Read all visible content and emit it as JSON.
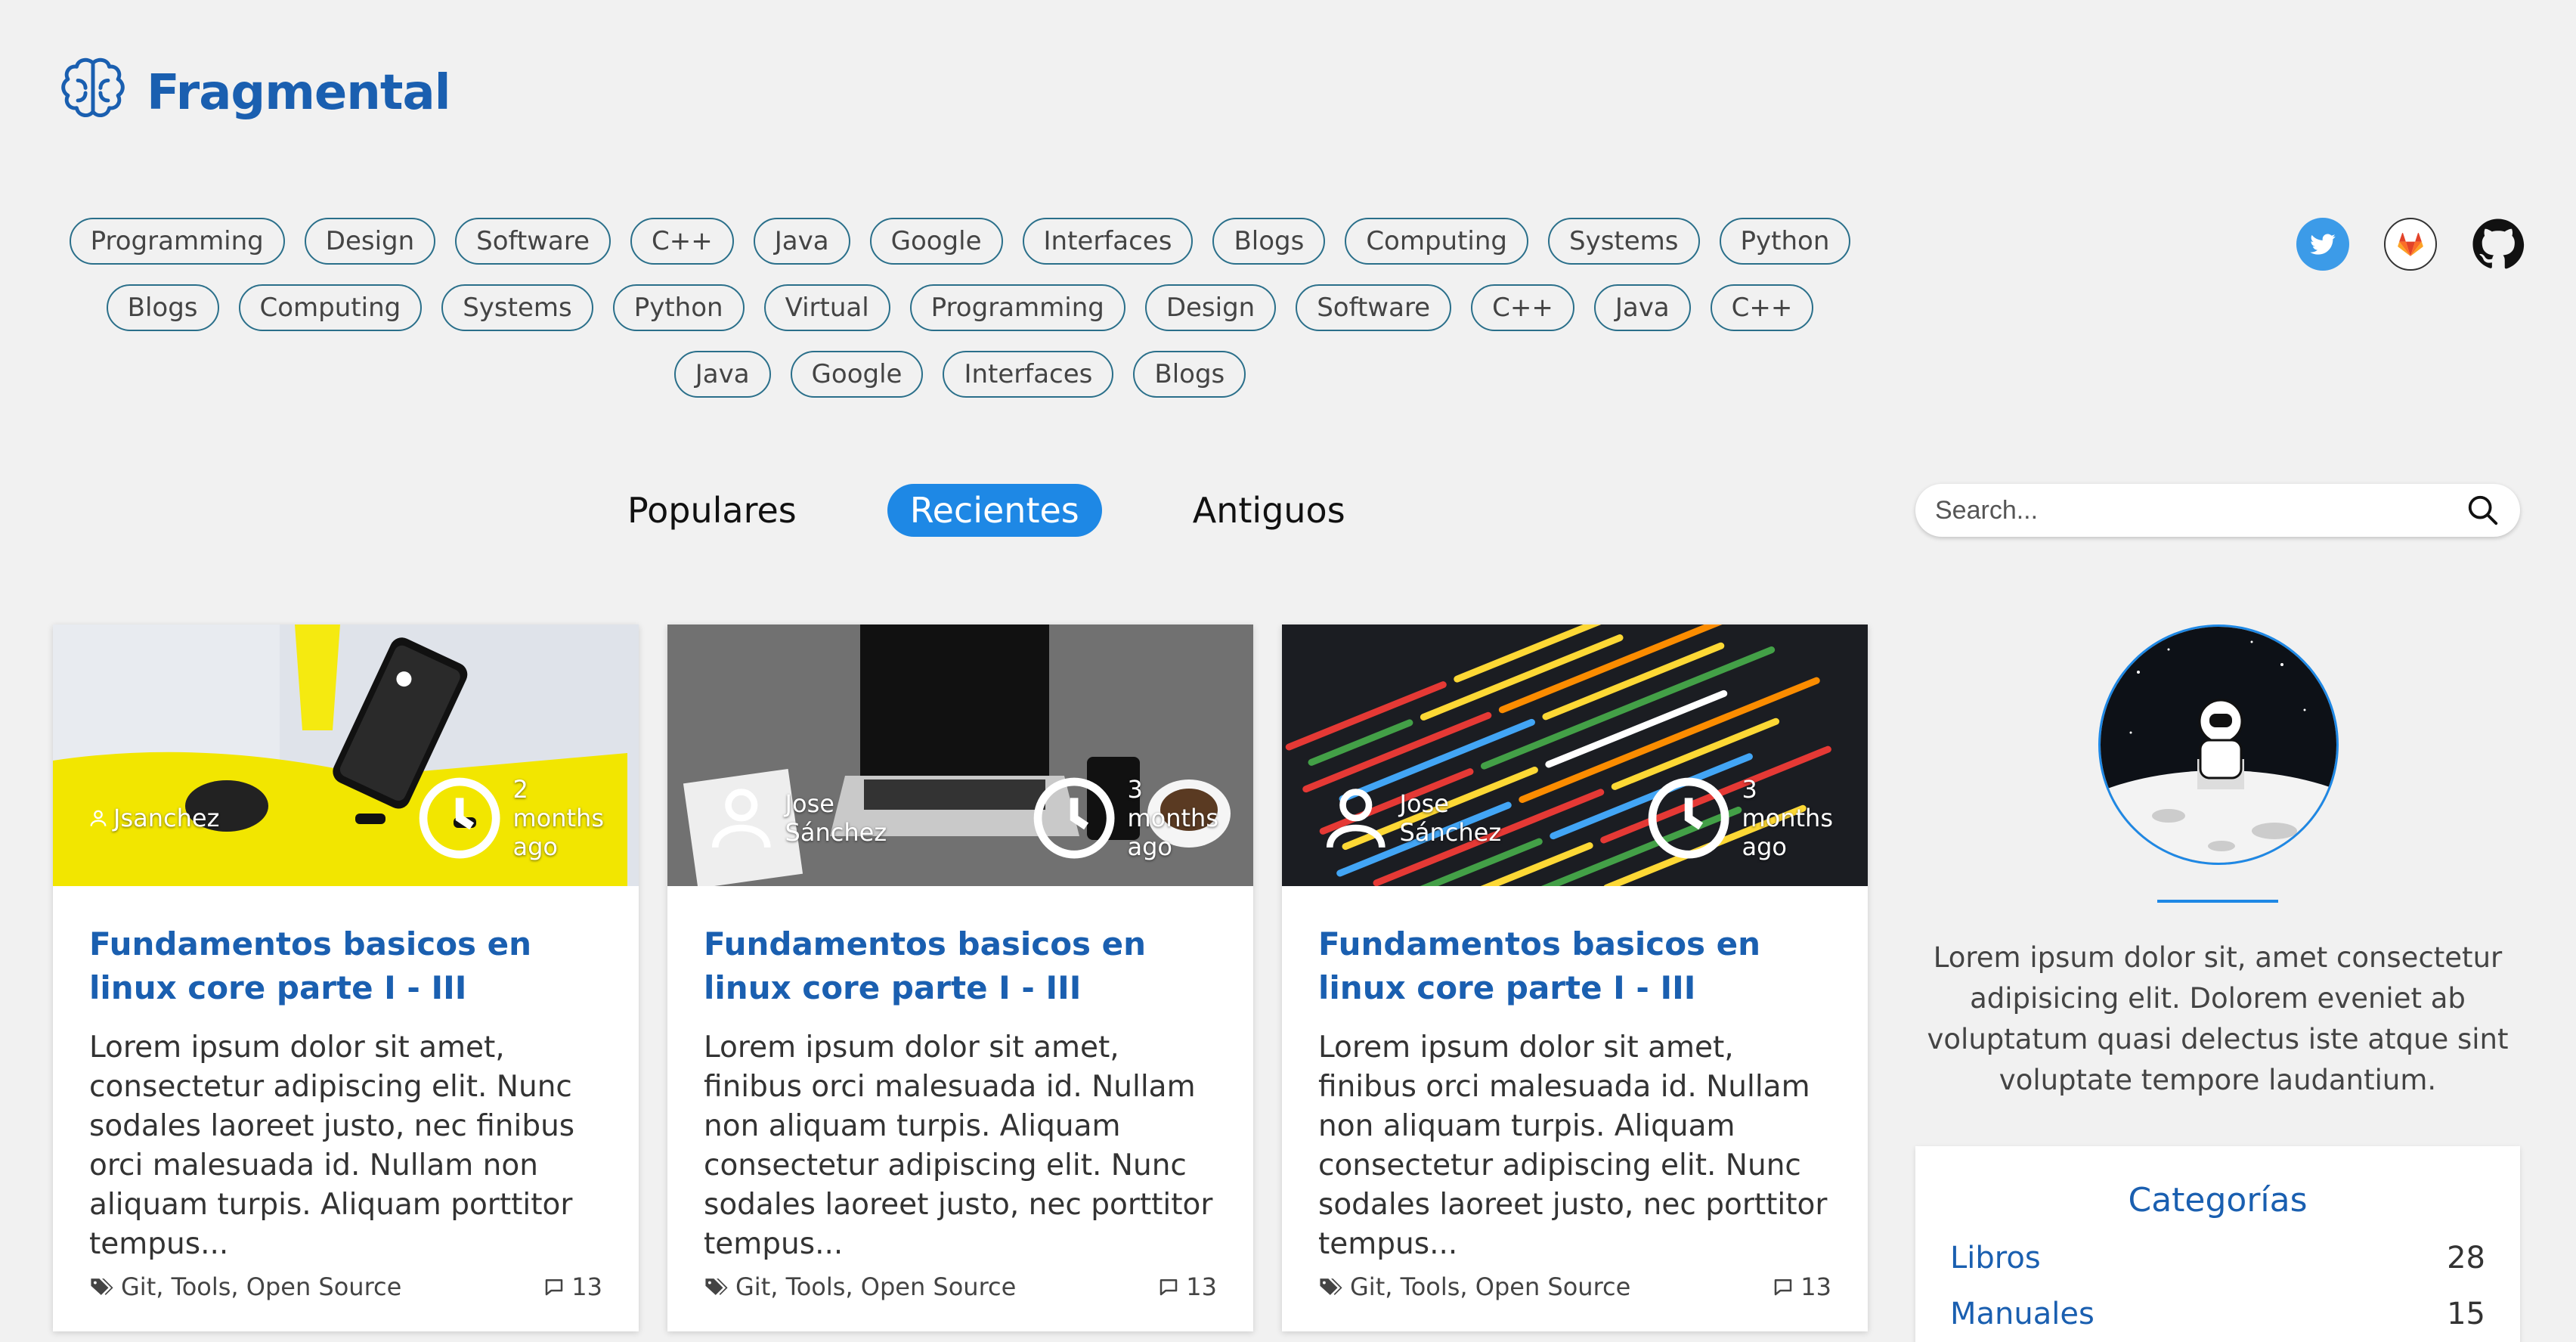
{
  "brand": {
    "name": "Fragmental",
    "color": "#1a5fb0"
  },
  "tags": [
    "Programming",
    "Design",
    "Software",
    "C++",
    "Java",
    "Google",
    "Interfaces",
    "Blogs",
    "Computing",
    "Systems",
    "Python",
    "Blogs",
    "Computing",
    "Systems",
    "Python",
    "Virtual",
    "Programming",
    "Design",
    "Software",
    "C++",
    "Java",
    "C++",
    "Java",
    "Google",
    "Interfaces",
    "Blogs"
  ],
  "social": [
    "twitter-icon",
    "gitlab-icon",
    "github-icon"
  ],
  "nav": {
    "tabs": [
      "Populares",
      "Recientes",
      "Antiguos"
    ],
    "active_index": 1
  },
  "search": {
    "placeholder": "Search..."
  },
  "cards": [
    {
      "author": "Jsanchez",
      "time": "2 months ago",
      "title": "Fundamentos basicos en linux core parte I - III",
      "excerpt": "Lorem ipsum dolor sit amet, consectetur adipiscing elit. Nunc sodales laoreet justo, nec finibus orci malesuada id. Nullam non aliquam turpis. Aliquam porttitor tempus...",
      "tags": "Git, Tools, Open Source",
      "comments": "13"
    },
    {
      "author": "Jose Sánchez",
      "time": "3 months ago",
      "title": "Fundamentos basicos en linux core parte I - III",
      "excerpt": "Lorem ipsum dolor sit amet, finibus orci malesuada id. Nullam non aliquam turpis. Aliquam consectetur adipiscing elit. Nunc sodales laoreet justo, nec porttitor tempus...",
      "tags": "Git, Tools, Open Source",
      "comments": "13"
    },
    {
      "author": "Jose Sánchez",
      "time": "3 months ago",
      "title": "Fundamentos basicos en linux core parte I - III",
      "excerpt": "Lorem ipsum dolor sit amet, finibus orci malesuada id. Nullam non aliquam turpis. Aliquam consectetur adipiscing elit. Nunc sodales laoreet justo, nec porttitor tempus...",
      "tags": "Git, Tools, Open Source",
      "comments": "13"
    }
  ],
  "sidebar": {
    "bio": "Lorem ipsum dolor sit, amet consectetur adipisicing elit. Dolorem eveniet ab voluptatum quasi delectus iste atque sint voluptate tempore laudantium.",
    "categories_title": "Categorías",
    "categories": [
      {
        "name": "Libros",
        "count": "28"
      },
      {
        "name": "Manuales",
        "count": "15"
      }
    ]
  }
}
